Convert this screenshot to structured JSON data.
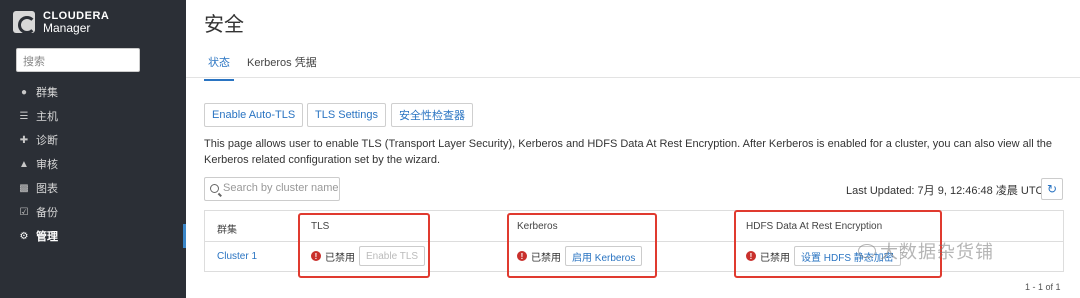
{
  "brand": {
    "line1": "CLOUDERA",
    "line2": "Manager"
  },
  "sidebar": {
    "search_placeholder": "搜索",
    "items": [
      {
        "label": "群集",
        "icon": "clusters-icon"
      },
      {
        "label": "主机",
        "icon": "hosts-icon"
      },
      {
        "label": "诊断",
        "icon": "diagnostics-icon"
      },
      {
        "label": "审核",
        "icon": "audit-icon"
      },
      {
        "label": "图表",
        "icon": "charts-icon"
      },
      {
        "label": "备份",
        "icon": "backup-icon"
      },
      {
        "label": "管理",
        "icon": "gear-icon"
      }
    ]
  },
  "page": {
    "title": "安全"
  },
  "tabs": [
    {
      "label": "状态"
    },
    {
      "label": "Kerberos 凭据"
    }
  ],
  "actions": {
    "auto_tls": "Enable Auto-TLS",
    "tls_settings": "TLS Settings",
    "checker": "安全性检查器"
  },
  "description": "This page allows user to enable TLS (Transport Layer Security), Kerberos and HDFS Data At Rest Encryption. After Kerberos is enabled for a cluster, you can also view all the Kerberos related configuration set by the wizard.",
  "filter": {
    "placeholder": "Search by cluster name"
  },
  "last_updated": "Last Updated: 7月 9, 12:46:48 凌晨 UTC",
  "table": {
    "headers": {
      "cluster": "群集",
      "tls": "TLS",
      "kerberos": "Kerberos",
      "hdfs": "HDFS Data At Rest Encryption"
    },
    "row": {
      "cluster": "Cluster 1",
      "tls_status": "已禁用",
      "tls_button": "Enable TLS",
      "kerberos_status": "已禁用",
      "kerberos_button": "启用 Kerberos",
      "hdfs_status": "已禁用",
      "hdfs_button": "设置 HDFS 静态加密"
    }
  },
  "pagination": "1 - 1 of 1",
  "watermark": "大数据杂货铺",
  "colors": {
    "sidebar": "#2b2f36",
    "accent": "#2a74c2",
    "highlight": "#e03a2f",
    "danger": "#c9302c"
  }
}
